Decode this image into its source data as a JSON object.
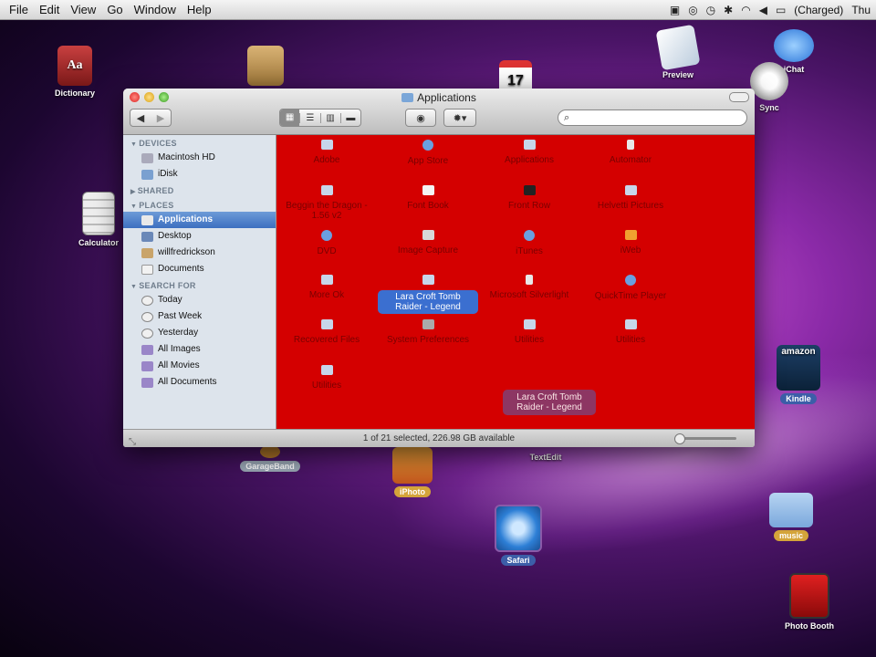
{
  "menubar": {
    "items": [
      "File",
      "Edit",
      "View",
      "Go",
      "Window",
      "Help"
    ],
    "battery": "(Charged)",
    "clock": "Thu"
  },
  "desktop": {
    "icons": {
      "dictionary": "Dictionary",
      "preview": "Preview",
      "calculator": "Calculator",
      "sync": "Sync",
      "facetime": "iChat",
      "kindle": "Kindle",
      "kindle_logo": "amazon",
      "garageband": "GarageBand",
      "iphoto": "iPhoto",
      "textedit": "TextEdit",
      "safari": "Safari",
      "music": "music",
      "photobooth": "Photo Booth",
      "calendar_day": "17"
    }
  },
  "window": {
    "title": "Applications",
    "search_placeholder": "",
    "status": "1 of 21 selected, 226.98 GB available",
    "sidebar": {
      "devices_header": "DEVICES",
      "devices": [
        "Macintosh HD",
        "iDisk"
      ],
      "shared_header": "SHARED",
      "places_header": "PLACES",
      "places": [
        "Applications",
        "Desktop",
        "willfredrickson",
        "Documents"
      ],
      "search_header": "SEARCH FOR",
      "search": [
        "Today",
        "Past Week",
        "Yesterday",
        "All Images",
        "All Movies",
        "All Documents"
      ]
    },
    "files": [
      {
        "name": "Adobe"
      },
      {
        "name": "App Store"
      },
      {
        "name": "Applications"
      },
      {
        "name": "Automator"
      },
      {
        "name": "Beggin the Dragon - 1.56 v2"
      },
      {
        "name": "Font Book"
      },
      {
        "name": "Front Row"
      },
      {
        "name": "Helvetti Pictures"
      },
      {
        "name": "DVD"
      },
      {
        "name": "Image Capture"
      },
      {
        "name": "iTunes"
      },
      {
        "name": "iWeb"
      },
      {
        "name": "More Ok"
      },
      {
        "name": "Lara Croft Tomb Raider - Legend"
      },
      {
        "name": "Microsoft Silverlight"
      },
      {
        "name": "QuickTime Player"
      },
      {
        "name": "Recovered Files"
      },
      {
        "name": "System Preferences"
      },
      {
        "name": "Utilities"
      },
      {
        "name": "Utilities"
      },
      {
        "name": "Utilities"
      }
    ],
    "drag_ghost": "Lara Croft Tomb Raider - Legend"
  }
}
